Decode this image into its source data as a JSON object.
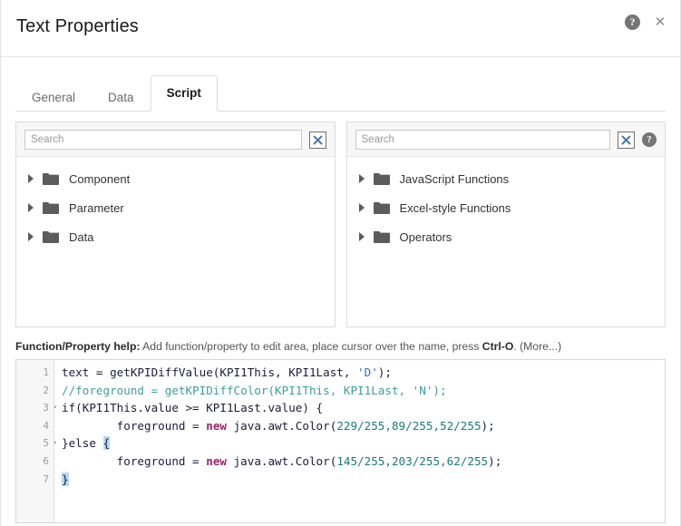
{
  "dialog": {
    "title": "Text Properties",
    "help_icon_label": "?",
    "close_icon_label": "✕"
  },
  "tabs": [
    {
      "label": "General",
      "active": false
    },
    {
      "label": "Data",
      "active": false
    },
    {
      "label": "Script",
      "active": true
    }
  ],
  "left_panel": {
    "search": {
      "placeholder": "Search",
      "value": ""
    },
    "clear_button_label": "clear",
    "items": [
      {
        "label": "Component"
      },
      {
        "label": "Parameter"
      },
      {
        "label": "Data"
      }
    ]
  },
  "right_panel": {
    "search": {
      "placeholder": "Search",
      "value": ""
    },
    "clear_button_label": "clear",
    "help_icon_label": "?",
    "items": [
      {
        "label": "JavaScript Functions"
      },
      {
        "label": "Excel-style Functions"
      },
      {
        "label": "Operators"
      }
    ]
  },
  "help_line": {
    "label": "Function/Property help:",
    "text": " Add function/property to edit area, place cursor over the name, press ",
    "shortcut": "Ctrl-O",
    "suffix": ". (More...)"
  },
  "editor": {
    "line_numbers": [
      "1",
      "2",
      "3",
      "4",
      "5",
      "6",
      "7"
    ],
    "fold_markers": {
      "3": "▾",
      "5": "▾"
    },
    "lines": [
      "text = getKPIDiffValue(KPI1This, KPI1Last, 'D');",
      "//foreground = getKPIDiffColor(KPI1This, KPI1Last, 'N');",
      "if(KPI1This.value >= KPI1Last.value) {",
      "        foreground = new java.awt.Color(229/255,89/255,52/255);",
      "}else {",
      "        foreground = new java.awt.Color(145/255,203/255,62/255);",
      "}"
    ],
    "line1": {
      "plain_a": "text = getKPIDiffValue(KPI1This, KPI1Last, ",
      "string": "'D'",
      "plain_b": ");"
    },
    "line2": {
      "comment": "//foreground = getKPIDiffColor(KPI1This, KPI1Last, 'N');"
    },
    "line3": {
      "plain": "if(KPI1This.value >= KPI1Last.value) {"
    },
    "line4": {
      "plain_a": "        foreground = ",
      "keyword": "new",
      "plain_b": " java.awt.Color(",
      "num1": "229/255,89/255,52/255",
      "plain_c": ");"
    },
    "line5": {
      "plain_a": "}else ",
      "brace": "{"
    },
    "line6": {
      "plain_a": "        foreground = ",
      "keyword": "new",
      "plain_b": " java.awt.Color(",
      "num1": "145/255,203/255,62/255",
      "plain_c": ");"
    },
    "line7": {
      "brace": "}"
    }
  },
  "colors": {
    "accent_folder": "#5c5c5c",
    "comment": "#3f9e9b",
    "string": "#2d6fd0",
    "keyword": "#a0246b",
    "number": "#1b7a7a",
    "brace_highlight": "#b3d9f5"
  }
}
